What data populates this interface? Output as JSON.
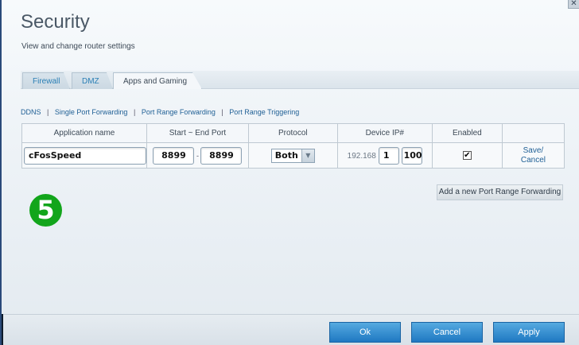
{
  "window": {
    "close_glyph": "✕"
  },
  "header": {
    "title": "Security",
    "subtitle": "View and change router settings"
  },
  "tabs": [
    {
      "label": "Firewall"
    },
    {
      "label": "DMZ"
    },
    {
      "label": "Apps and Gaming"
    }
  ],
  "sublinks": [
    "DDNS",
    "Single Port Forwarding",
    "Port Range Forwarding",
    "Port Range Triggering"
  ],
  "table": {
    "headers": [
      "Application name",
      "Start ~ End Port",
      "Protocol",
      "Device IP#",
      "Enabled",
      ""
    ],
    "row": {
      "app_name": "cFosSpeed",
      "start_port": "8899",
      "end_port": "8899",
      "port_separator": "-",
      "protocol": "Both",
      "ip_prefix": "192.168",
      "ip_octet3": "1",
      "ip_octet4": "100",
      "enabled_check": "✔",
      "save_label": "Save/",
      "cancel_label": "Cancel"
    }
  },
  "add_button_label": "Add a new Port Range Forwarding",
  "step_badge": "5",
  "footer": {
    "ok_label": "Ok",
    "cancel_label": "Cancel",
    "apply_label": "Apply"
  },
  "colors": {
    "accent_blue": "#1f78c2",
    "link_blue": "#1f5f95",
    "badge_green": "#12a51b"
  }
}
